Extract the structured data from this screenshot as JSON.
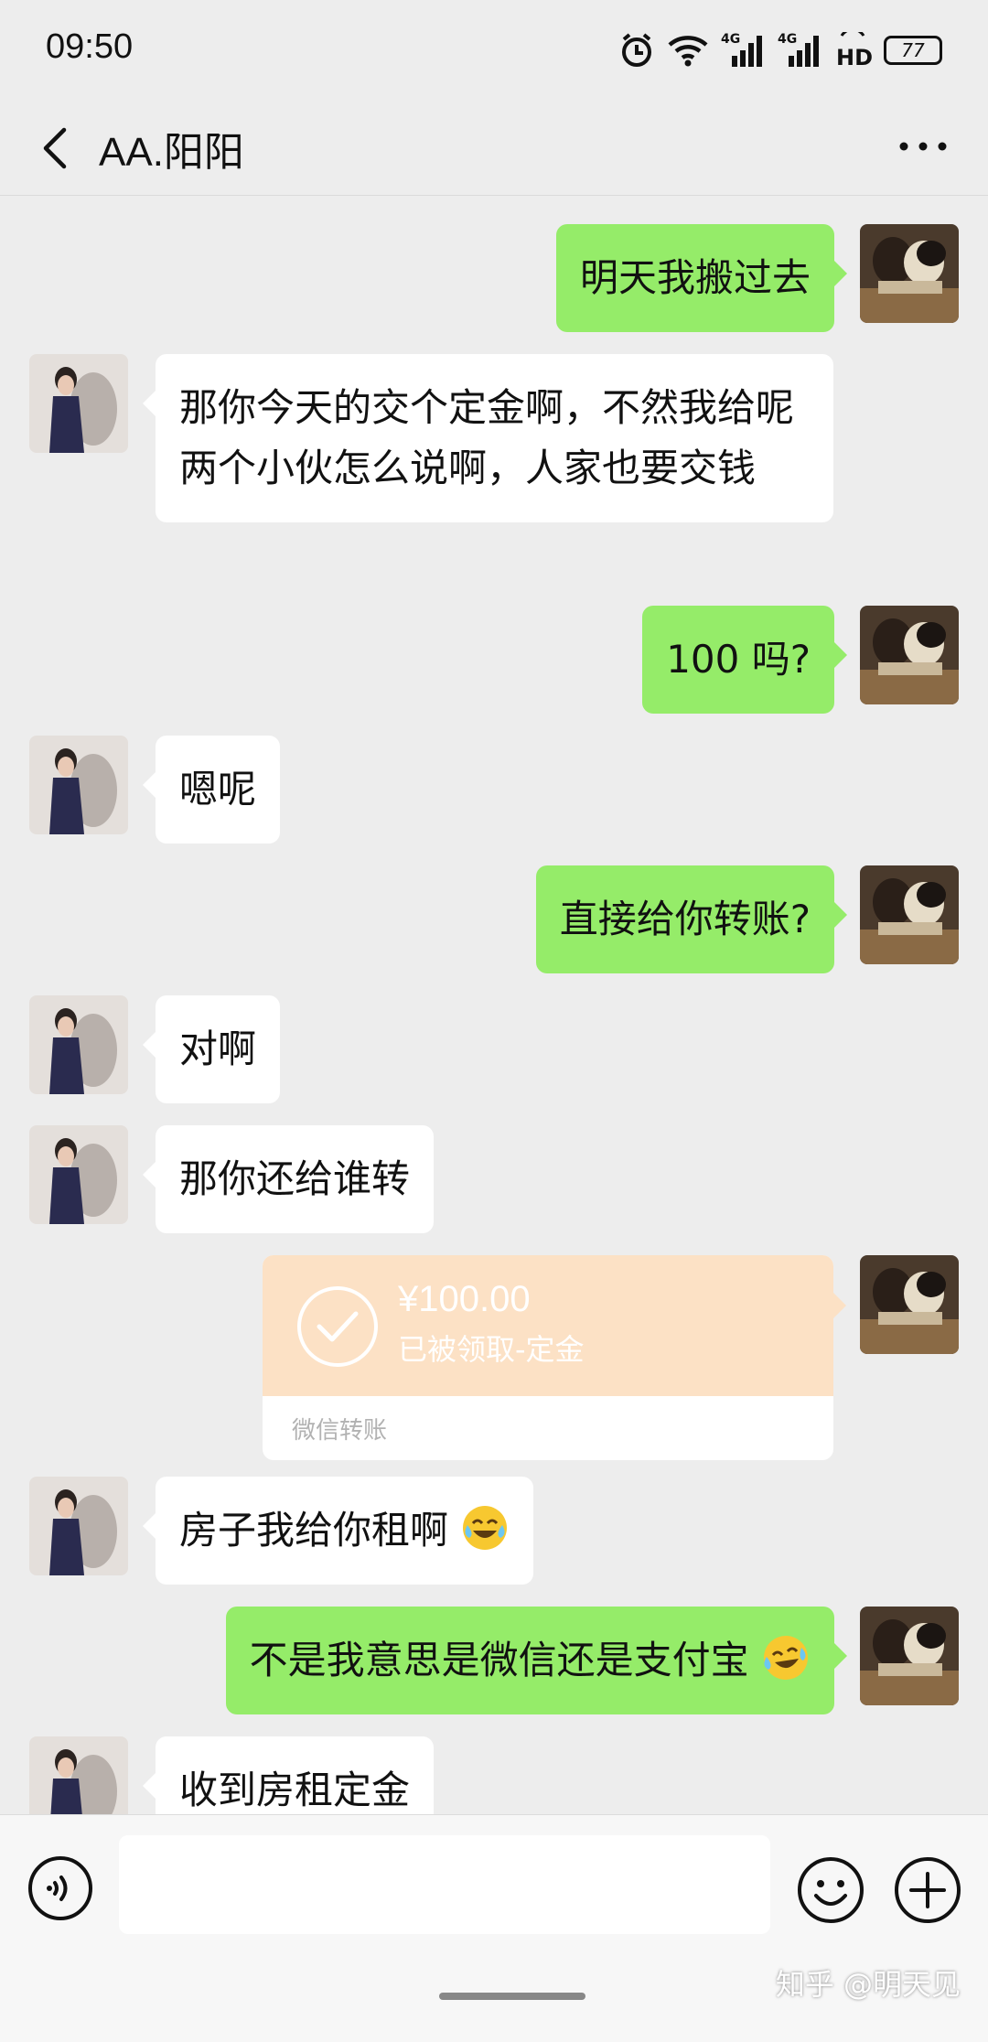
{
  "status_bar": {
    "time": "09:50",
    "battery": "77",
    "network_1": "4G",
    "network_2": "4G",
    "hd": "HD"
  },
  "header": {
    "title": "AA.阳阳"
  },
  "messages": [
    {
      "side": "out",
      "text": "明天我搬过去"
    },
    {
      "side": "in",
      "text": "那你今天的交个定金啊，不然我给呢两个小伙怎么说啊，人家也要交钱"
    },
    {
      "side": "out",
      "text": "100 吗?"
    },
    {
      "side": "in",
      "text": "嗯呢"
    },
    {
      "side": "out",
      "text": "直接给你转账?"
    },
    {
      "side": "in",
      "text": "对啊"
    },
    {
      "side": "in",
      "text": "那你还给谁转"
    },
    {
      "side": "in",
      "text": "房子我给你租啊",
      "emoji": "tears-of-joy-emoji"
    },
    {
      "side": "out",
      "text": "不是我意思是微信还是支付宝",
      "emoji": "crying-laughing-emoji"
    },
    {
      "side": "in",
      "text": "收到房租定金"
    }
  ],
  "transfer": {
    "amount": "¥100.00",
    "status": "已被领取-定金",
    "label": "微信转账"
  },
  "watermark": "知乎 @明天见",
  "colors": {
    "background": "#ededed",
    "out_bubble": "#95ec69",
    "in_bubble": "#ffffff",
    "transfer": "#fce1c5"
  }
}
